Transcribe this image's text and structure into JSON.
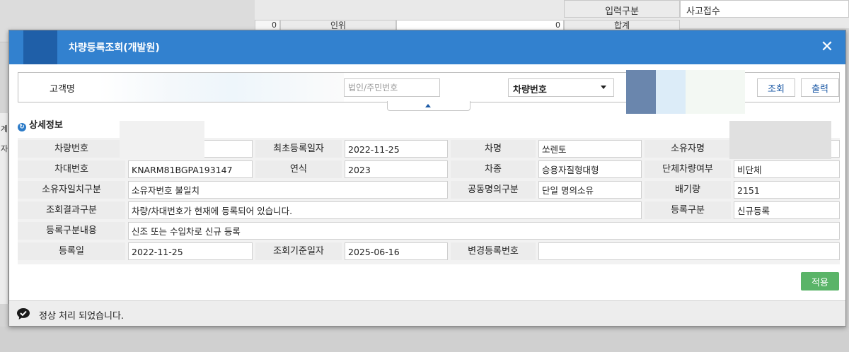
{
  "background": {
    "input_type_label": "입력구분",
    "input_type_value": "사고접수",
    "row2_label": "인위",
    "row2_total_label": "합계",
    "row2_val1": "0",
    "row2_val2": "0",
    "left_col": [
      "계",
      "자"
    ]
  },
  "modal": {
    "title": "차량등록조회(개발원)",
    "close_label": "✕"
  },
  "search": {
    "customer_label": "고객명",
    "id_placeholder": "법인/주민번호",
    "vehicle_select_value": "차량번호",
    "search_button": "조회",
    "print_button": "출력"
  },
  "section": {
    "title": "상세정보"
  },
  "details": {
    "plate_label": "차량번호",
    "first_reg_label": "최초등록일자",
    "first_reg_value": "2022-11-25",
    "car_name_label": "차명",
    "car_name_value": "쏘렌토",
    "owner_label": "소유자명",
    "vin_label": "차대번호",
    "vin_value": "KNARM81BGPA193147",
    "year_label": "연식",
    "year_value": "2023",
    "car_kind_label": "차종",
    "car_kind_value": "승용자질형대형",
    "group_label": "단체차량여부",
    "group_value": "비단체",
    "owner_match_label": "소유자일치구분",
    "owner_match_value": "소유자번호 불일치",
    "co_owner_label": "공동명의구분",
    "co_owner_value": "단일 명의소유",
    "displacement_label": "배기량",
    "displacement_value": "2151",
    "result_label": "조회결과구분",
    "result_value": "차량/차대번호가 현재에 등록되어 있습니다.",
    "reg_type_label": "등록구분",
    "reg_type_value": "신규등록",
    "reg_desc_label": "등록구분내용",
    "reg_desc_value": "신조 또는 수입차로 신규 등록",
    "reg_date_label": "등록일",
    "reg_date_value": "2022-11-25",
    "query_date_label": "조회기준일자",
    "query_date_value": "2025-06-16",
    "change_no_label": "변경등록번호",
    "change_no_value": ""
  },
  "footer": {
    "apply_button": "적용",
    "status_message": "정상 처리 되었습니다."
  },
  "colors": {
    "title_bar": "#3281cf",
    "apply_button": "#5ab468",
    "link_button_text": "#1d5aa6"
  }
}
